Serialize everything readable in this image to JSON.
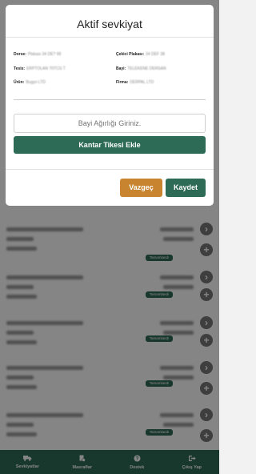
{
  "modal": {
    "title": "Aktif sevkiyat",
    "fields": {
      "dorse": {
        "label": "Dorse:",
        "value": "Plakası 34 DE? 99"
      },
      "cekici_plakasi": {
        "label": "Çekici Plakası:",
        "value": "34 DEF 38"
      },
      "tesis": {
        "label": "Tesis:",
        "value": "ERPTOLAN 70TCG T"
      },
      "bayi": {
        "label": "Bayi:",
        "value": "TELEKENE DERSAN"
      },
      "urun": {
        "label": "Ürün:",
        "value": "Bugyo LTD"
      },
      "firma": {
        "label": "Firma:",
        "value": "DERPAL LTD"
      }
    },
    "input_placeholder": "Bayi Ağırlığı Giriniz.",
    "add_button": "Kantar Tikesi Ekle",
    "cancel_button": "Vazgeç",
    "save_button": "Kaydet"
  },
  "list": {
    "status_badge": "Tamamlandı",
    "arrow_icon": "chevron-right-icon",
    "plus_icon": "plus-icon"
  },
  "bottom_nav": [
    {
      "label": "Sevkiyatlar",
      "icon": "truck-icon"
    },
    {
      "label": "Masraflar",
      "icon": "receipt-icon"
    },
    {
      "label": "Destek",
      "icon": "help-icon"
    },
    {
      "label": "Çıkış Yap",
      "icon": "logout-icon"
    }
  ],
  "colors": {
    "primary": "#2e6b56",
    "cancel": "#c8842f",
    "overlay": "rgba(0,0,0,0.48)"
  }
}
